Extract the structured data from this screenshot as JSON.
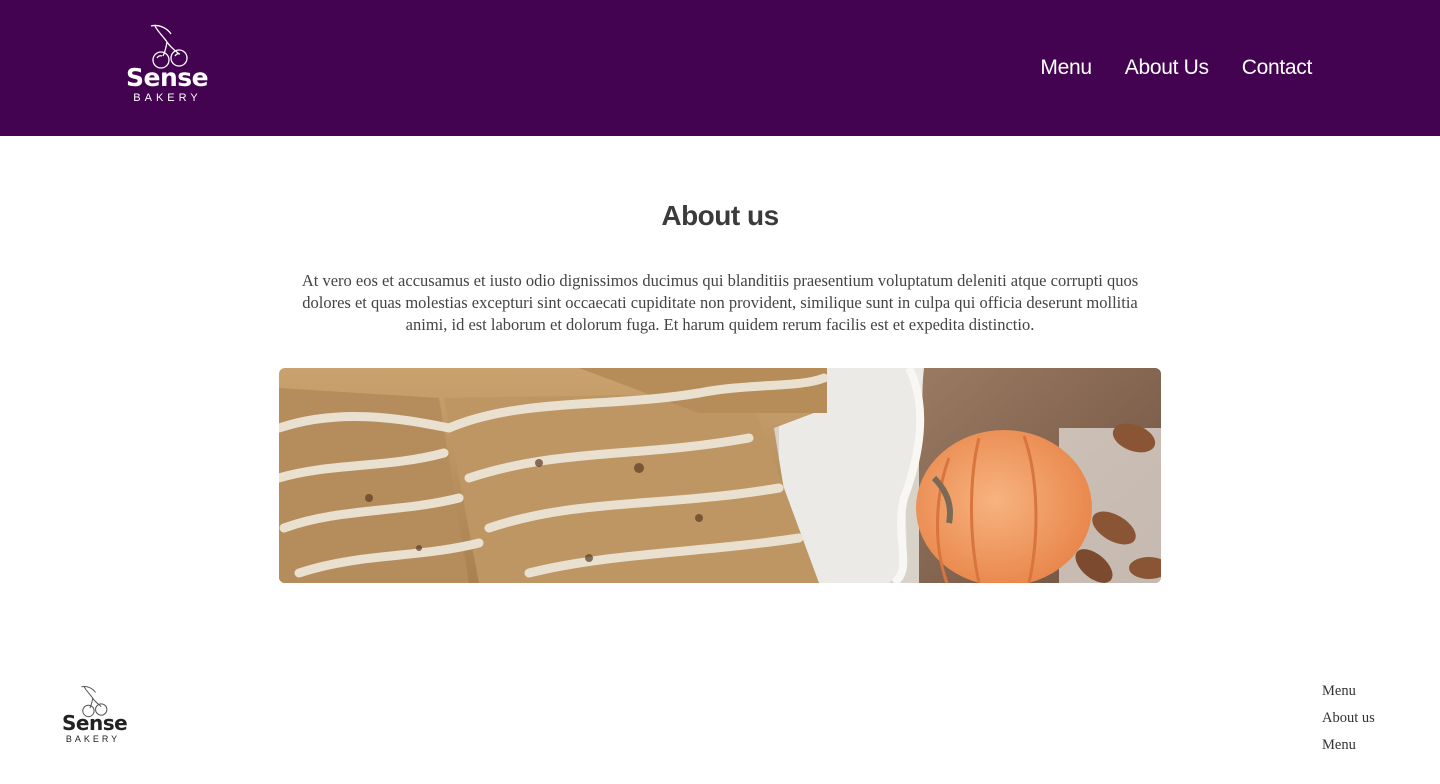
{
  "header": {
    "logo": {
      "brand": "Sense",
      "subtitle": "BAKERY",
      "icon": "cherry-icon"
    },
    "nav": [
      {
        "label": "Menu"
      },
      {
        "label": "About Us"
      },
      {
        "label": "Contact"
      }
    ],
    "background_color": "#430350"
  },
  "main": {
    "title": "About us",
    "paragraph": "At vero eos et accusamus et iusto odio dignissimos ducimus qui blanditiis praesentium voluptatum deleniti atque corrupti quos dolores et quas molestias excepturi sint occaecati cupiditate non provident, similique sunt in culpa qui officia deserunt mollitia animi, id est laborum et dolorum fuga. Et harum quidem rerum facilis est et expedita distinctio.",
    "hero_image": "scones-and-pumpkin-image"
  },
  "footer": {
    "logo": {
      "brand": "Sense",
      "subtitle": "BAKERY",
      "icon": "cherry-icon"
    },
    "links": [
      {
        "label": "Menu"
      },
      {
        "label": "About us"
      },
      {
        "label": "Menu"
      }
    ]
  }
}
